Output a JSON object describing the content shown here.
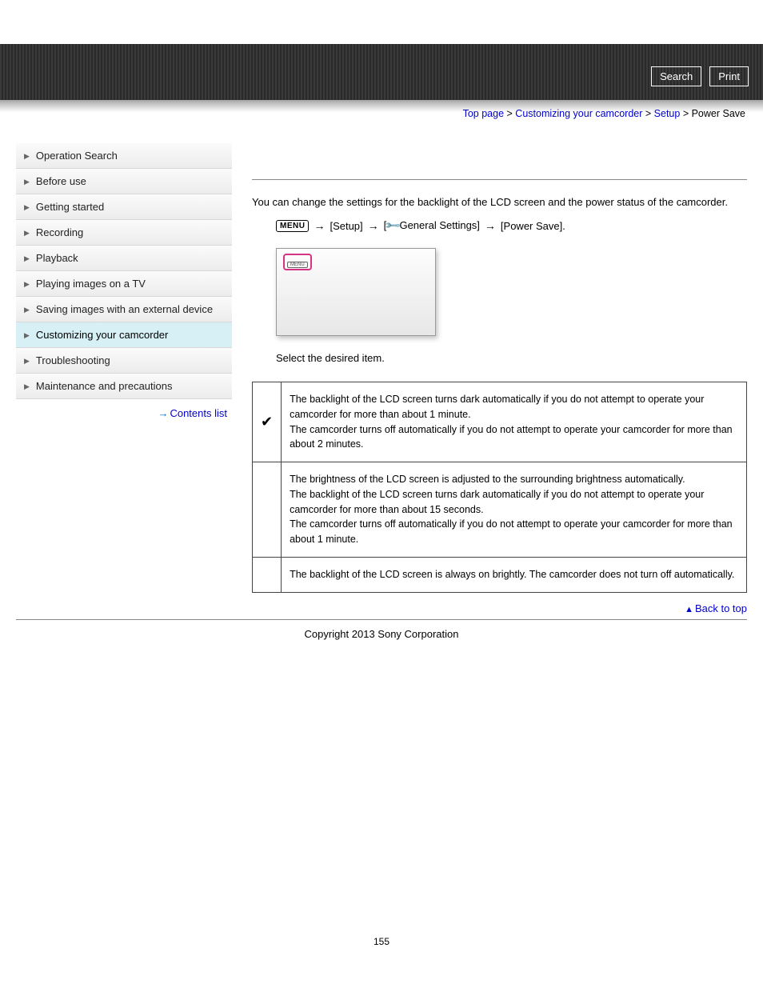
{
  "header": {
    "search": "Search",
    "print": "Print"
  },
  "breadcrumb": {
    "top": "Top page",
    "customizing": "Customizing your camcorder",
    "setup": "Setup",
    "current": "Power Save"
  },
  "sidebar": {
    "items": [
      "Operation Search",
      "Before use",
      "Getting started",
      "Recording",
      "Playback",
      "Playing images on a TV",
      "Saving images with an external device",
      "Customizing your camcorder",
      "Troubleshooting",
      "Maintenance and precautions"
    ],
    "activeIndex": 7,
    "contents_link": "Contents list"
  },
  "content": {
    "intro": "You can change the settings for the backlight of the LCD screen and the power status of the camcorder.",
    "menu_label": "MENU",
    "path": {
      "setup": "[Setup]",
      "general_prefix": "[",
      "general_label": "General Settings]",
      "power_save": "[Power Save]."
    },
    "screenshot_menu": "MENU",
    "step": "Select the desired item.",
    "options": [
      {
        "checked": true,
        "text": "The backlight of the LCD screen turns dark automatically if you do not attempt to operate your camcorder for more than about 1 minute.\nThe camcorder turns off automatically if you do not attempt to operate your camcorder for more than about 2 minutes."
      },
      {
        "checked": false,
        "text": "The brightness of the LCD screen is adjusted to the surrounding brightness automatically.\nThe backlight of the LCD screen turns dark automatically if you do not attempt to operate your camcorder for more than about 15 seconds.\nThe camcorder turns off automatically if you do not attempt to operate your camcorder for more than about 1 minute."
      },
      {
        "checked": false,
        "text": "The backlight of the LCD screen is always on brightly. The camcorder does not turn off automatically."
      }
    ],
    "back_to_top": "Back to top"
  },
  "footer": {
    "copyright": "Copyright 2013 Sony Corporation",
    "page": "155"
  }
}
